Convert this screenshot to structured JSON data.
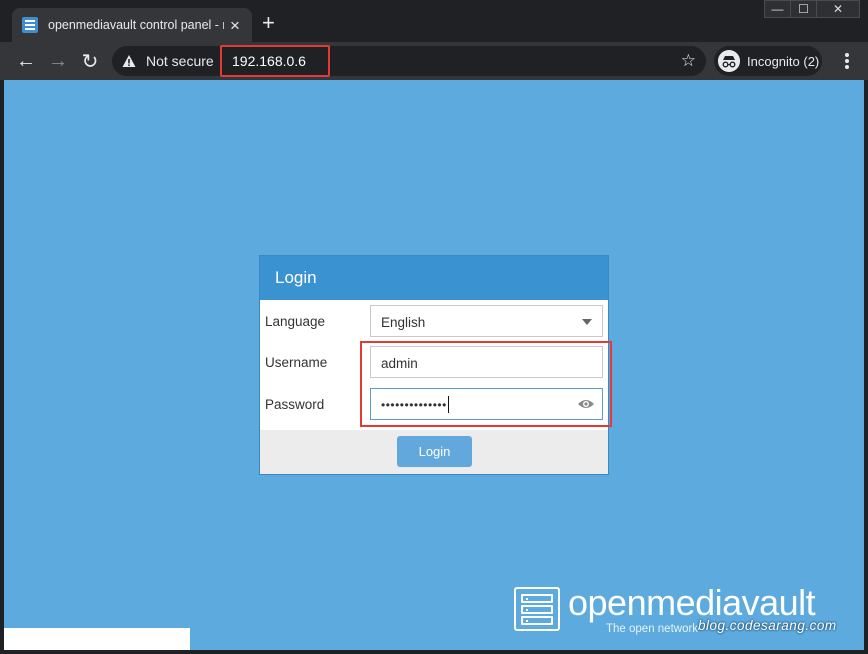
{
  "browser": {
    "tab": {
      "title": "openmediavault control panel - r",
      "icon": "openmediavault-favicon"
    },
    "new_tab_label": "+",
    "window_controls": {
      "minimize": "—",
      "maximize": "☐",
      "close": "✕"
    },
    "nav": {
      "back": "←",
      "forward": "→",
      "reload": "↻"
    },
    "address_bar": {
      "security_label": "Not secure",
      "url": "192.168.0.6",
      "star": "☆"
    },
    "incognito_label": "Incognito (2)"
  },
  "login": {
    "title": "Login",
    "language": {
      "label": "Language",
      "value": "English"
    },
    "username": {
      "label": "Username",
      "value": "admin"
    },
    "password": {
      "label": "Password",
      "value": "••••••••••••••"
    },
    "submit_label": "Login"
  },
  "branding": {
    "name": "openmediavault",
    "tagline": "The open network"
  },
  "watermark": "blog.codesarang.com",
  "colors": {
    "page_background": "#5daadf",
    "panel_header": "#3b92d1",
    "login_button": "#62a8dc",
    "highlight": "#e53935"
  }
}
